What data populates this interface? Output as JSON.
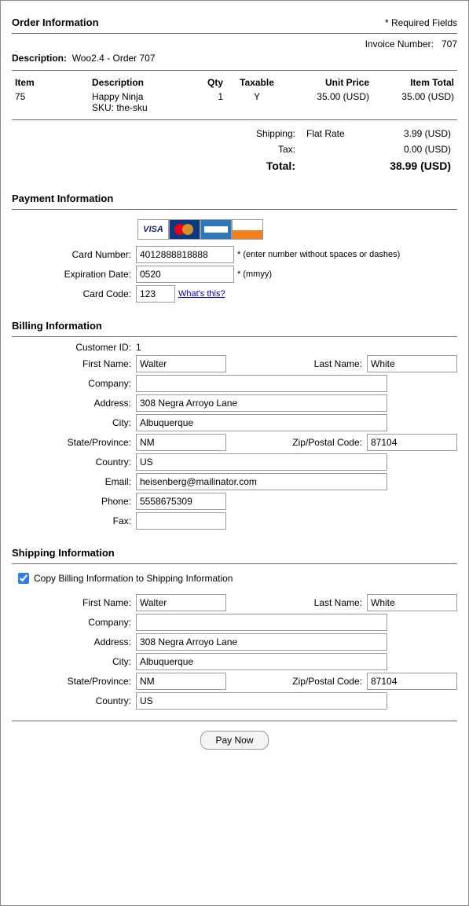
{
  "header": {
    "title": "Order Information",
    "required": "* Required Fields",
    "invoice_label": "Invoice Number:",
    "invoice_number": "707",
    "description_label": "Description:",
    "description_value": "Woo2.4 - Order 707"
  },
  "items_table": {
    "headers": {
      "item": "Item",
      "description": "Description",
      "qty": "Qty",
      "taxable": "Taxable",
      "unit_price": "Unit Price",
      "item_total": "Item Total"
    },
    "rows": [
      {
        "item": "75",
        "description": "Happy Ninja",
        "sku": "SKU: the-sku",
        "qty": "1",
        "taxable": "Y",
        "unit_price": "35.00 (USD)",
        "item_total": "35.00 (USD)"
      }
    ]
  },
  "totals": {
    "shipping_label": "Shipping:",
    "shipping_method": "Flat Rate",
    "shipping_amount": "3.99 (USD)",
    "tax_label": "Tax:",
    "tax_amount": "0.00 (USD)",
    "total_label": "Total:",
    "total_amount": "38.99 (USD)"
  },
  "payment": {
    "title": "Payment Information",
    "card_number_label": "Card Number:",
    "card_number": "4012888818888",
    "card_number_hint": "* (enter number without spaces or dashes)",
    "expiration_label": "Expiration Date:",
    "expiration": "0520",
    "expiration_hint": "* (mmyy)",
    "card_code_label": "Card Code:",
    "card_code": "123",
    "card_code_link": "What's this?"
  },
  "billing": {
    "title": "Billing Information",
    "customer_id_label": "Customer ID:",
    "customer_id": "1",
    "first_name_label": "First Name:",
    "first_name": "Walter",
    "last_name_label": "Last Name:",
    "last_name": "White",
    "company_label": "Company:",
    "company": "",
    "address_label": "Address:",
    "address": "308 Negra Arroyo Lane",
    "city_label": "City:",
    "city": "Albuquerque",
    "state_label": "State/Province:",
    "state": "NM",
    "zip_label": "Zip/Postal Code:",
    "zip": "87104",
    "country_label": "Country:",
    "country": "US",
    "email_label": "Email:",
    "email": "heisenberg@mailinator.com",
    "phone_label": "Phone:",
    "phone": "5558675309",
    "fax_label": "Fax:",
    "fax": ""
  },
  "shipping": {
    "title": "Shipping Information",
    "copy_label": "Copy Billing Information to Shipping Information",
    "first_name_label": "First Name:",
    "first_name": "Walter",
    "last_name_label": "Last Name:",
    "last_name": "White",
    "company_label": "Company:",
    "company": "",
    "address_label": "Address:",
    "address": "308 Negra Arroyo Lane",
    "city_label": "City:",
    "city": "Albuquerque",
    "state_label": "State/Province:",
    "state": "NM",
    "zip_label": "Zip/Postal Code:",
    "zip": "87104",
    "country_label": "Country:",
    "country": "US"
  },
  "buttons": {
    "pay_now": "Pay Now"
  }
}
